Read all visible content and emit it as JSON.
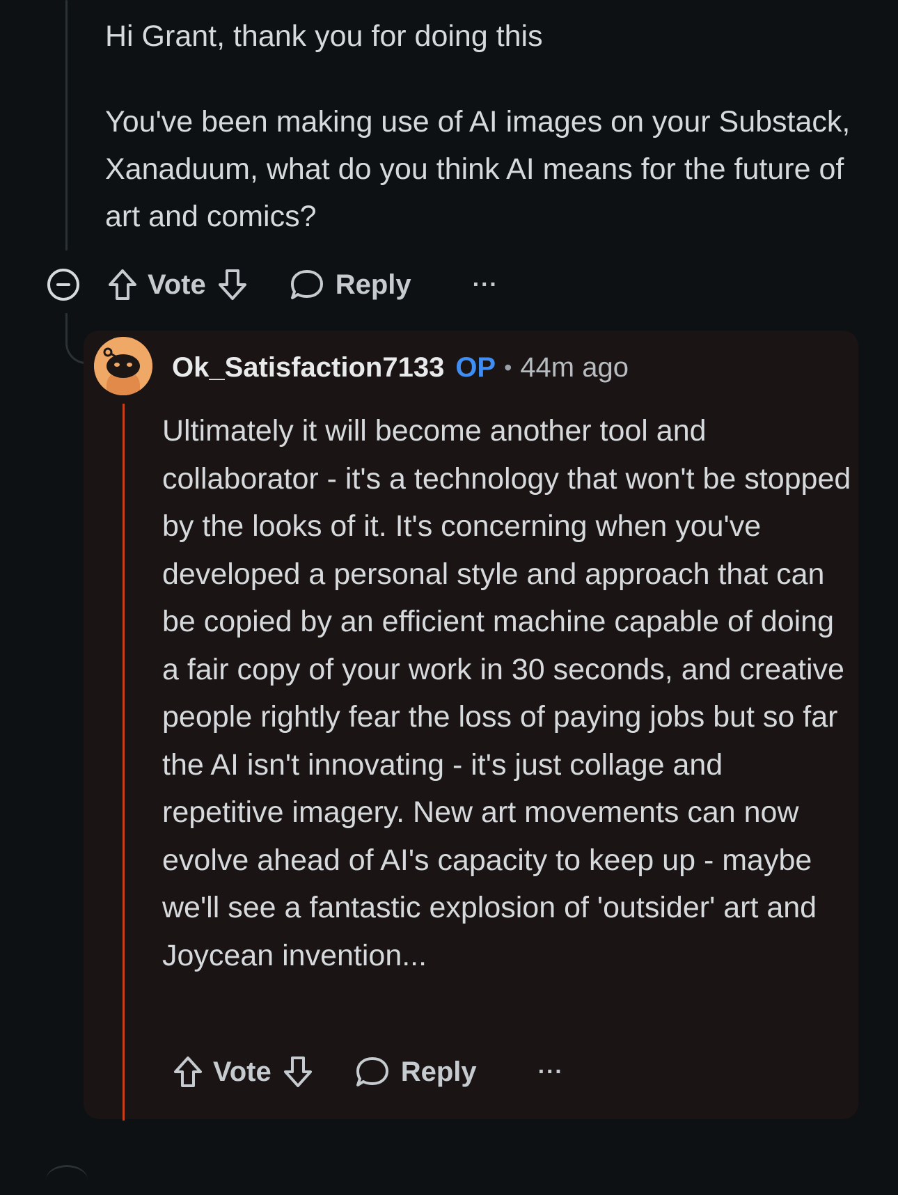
{
  "parent_comment": {
    "paragraphs": [
      "Hi Grant, thank you for doing this",
      "You've been making use of AI images on your Substack, Xanaduum, what do you think AI means for the future of art and comics?"
    ],
    "actions": {
      "vote_label": "Vote",
      "reply_label": "Reply",
      "more_label": "···"
    }
  },
  "reply_comment": {
    "username": "Ok_Satisfaction7133",
    "op_badge": "OP",
    "separator": "•",
    "time": "44m ago",
    "body": "Ultimately it will become another tool and collaborator - it's a technology that won't be stopped by the looks of it. It's concerning when you've developed a personal style and approach that can be copied by an efficient machine capable of doing a fair copy of your work in 30 seconds, and creative people rightly fear the loss of paying jobs but so far the AI isn't innovating - it's just collage and repetitive imagery. New art movements can now evolve ahead of AI's capacity to keep up - maybe we'll see a fantastic explosion of 'outsider' art and Joycean invention...",
    "actions": {
      "vote_label": "Vote",
      "reply_label": "Reply",
      "more_label": "···"
    }
  },
  "icons": [
    "collapse-icon",
    "upvote-icon",
    "downvote-icon",
    "reply-bubble-icon",
    "more-options-icon",
    "avatar-snoo"
  ],
  "colors": {
    "background": "#0e1113",
    "card": "#1a1414",
    "op_badge": "#3f8ef5",
    "thread_accent": "#c6401c",
    "avatar": "#f0a867"
  }
}
